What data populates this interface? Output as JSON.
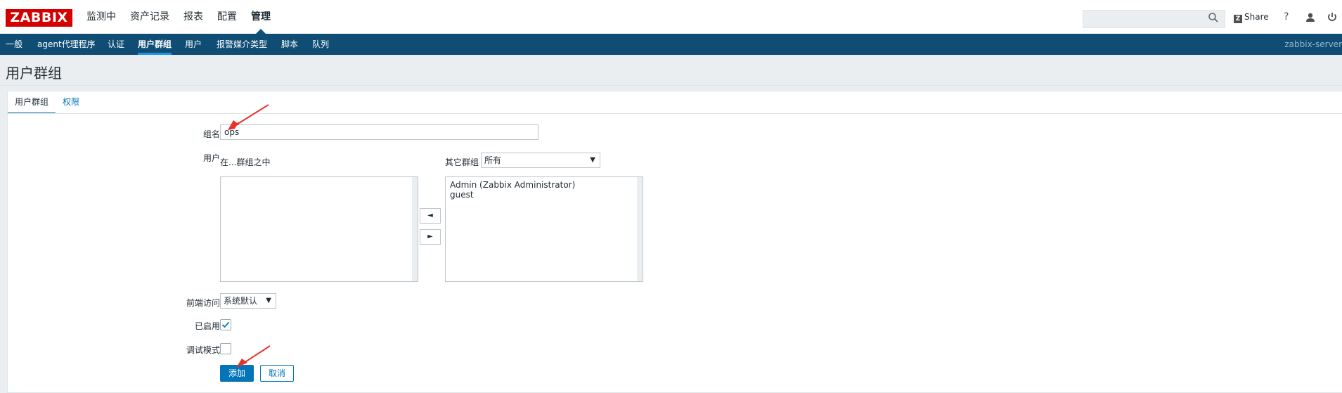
{
  "topbar": {
    "logo": "ZABBIX",
    "menu": [
      {
        "label": "监测中"
      },
      {
        "label": "资产记录"
      },
      {
        "label": "报表"
      },
      {
        "label": "配置"
      },
      {
        "label": "管理"
      }
    ],
    "search": {
      "placeholder": "",
      "icon": "search-icon"
    },
    "share_label": "Share",
    "share_badge": "Z",
    "help_label": "?",
    "icons": [
      "user-icon",
      "power-icon"
    ]
  },
  "subnav": {
    "items": [
      {
        "label": "一般"
      },
      {
        "label": "agent代理程序"
      },
      {
        "label": "认证"
      },
      {
        "label": "用户群组"
      },
      {
        "label": "用户"
      },
      {
        "label": "报警媒介类型"
      },
      {
        "label": "脚本"
      },
      {
        "label": "队列"
      }
    ],
    "server": "zabbix-server"
  },
  "page": {
    "title": "用户群组"
  },
  "tabs": [
    {
      "label": "用户群组"
    },
    {
      "label": "权限"
    }
  ],
  "form": {
    "group_name_label": "组名",
    "group_name_value": "ops",
    "users_label": "用户",
    "in_groups_label": "在...群组之中",
    "other_groups_label": "其它群组",
    "other_groups_select": "所有",
    "other_users": [
      "Admin (Zabbix Administrator)",
      "guest"
    ],
    "move_left": "◄",
    "move_right": "►",
    "frontend_access_label": "前端访问",
    "frontend_access_value": "系统默认",
    "enabled_label": "已启用",
    "enabled_checked": true,
    "debug_label": "调试模式",
    "debug_checked": false,
    "add_button": "添加",
    "cancel_button": "取消"
  },
  "colors": {
    "logo_bg": "#d40000",
    "subnav_bg": "#0f4d75",
    "primary": "#0275b8",
    "annotation_arrow": "#e8312a"
  }
}
